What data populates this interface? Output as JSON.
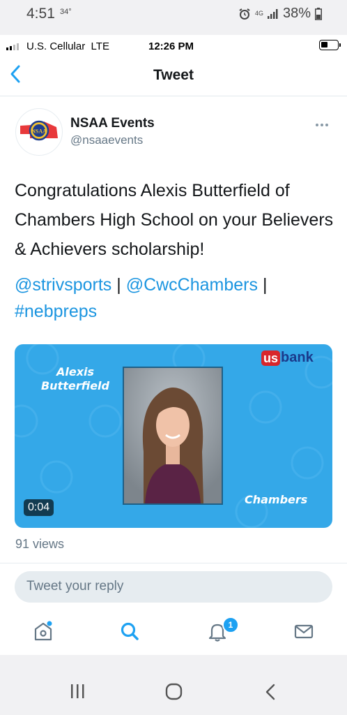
{
  "android_status": {
    "time": "4:51",
    "temp": "34°",
    "battery": "38%",
    "network": "4G"
  },
  "ios_status": {
    "carrier": "U.S. Cellular",
    "network": "LTE",
    "time": "12:26 PM"
  },
  "header": {
    "title": "Tweet",
    "back_icon": "chevron-left-icon"
  },
  "tweet": {
    "display_name": "NSAA Events",
    "handle": "@nsaaevents",
    "avatar_text": "NSAA",
    "text": "Congratulations Alexis Butterfield of Chambers High School on your Believers & Achievers scholarship!",
    "links": {
      "link1": "@strivsports",
      "sep1": " | ",
      "link2": "@CwcChambers",
      "sep2": " |",
      "link3": "#nebpreps"
    },
    "media": {
      "name_line1": "Alexis",
      "name_line2": "Butterfield",
      "school": "Chambers",
      "sponsor_us": "us",
      "sponsor_bank": "bank",
      "duration": "0:04"
    },
    "views": "91 views"
  },
  "reply": {
    "placeholder": "Tweet your reply"
  },
  "tabs": {
    "notifications_badge": "1"
  },
  "colors": {
    "accent": "#1da1f2",
    "link": "#1b95e0",
    "media_bg": "#34a8e8",
    "text": "#14171a",
    "muted": "#657786"
  }
}
